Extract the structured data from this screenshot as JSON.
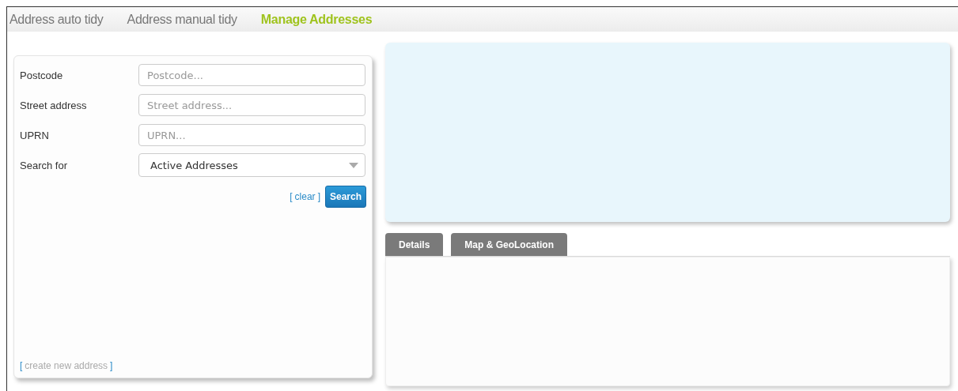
{
  "nav_tabs": [
    {
      "label": "Address auto tidy",
      "selected": false
    },
    {
      "label": "Address manual tidy",
      "selected": false
    },
    {
      "label": "Manage Addresses",
      "selected": true
    }
  ],
  "search_form": {
    "fields": [
      {
        "kind": "text",
        "label": "Postcode",
        "placeholder": "Postcode..."
      },
      {
        "kind": "text",
        "label": "Street address",
        "placeholder": "Street address..."
      },
      {
        "kind": "text",
        "label": "UPRN",
        "placeholder": "UPRN..."
      },
      {
        "kind": "select",
        "label": "Search for",
        "value": "Active Addresses"
      }
    ],
    "clear_link": {
      "bracket_open": "[",
      "label": "clear",
      "bracket_close": "]"
    },
    "search_button": "Search",
    "create_link": {
      "bracket_open": "[",
      "label": "create new address",
      "bracket_close": "]"
    }
  },
  "detail_tabs": [
    {
      "label": "Details",
      "selected": false
    },
    {
      "label": "Map & GeoLocation",
      "selected": false
    }
  ]
}
